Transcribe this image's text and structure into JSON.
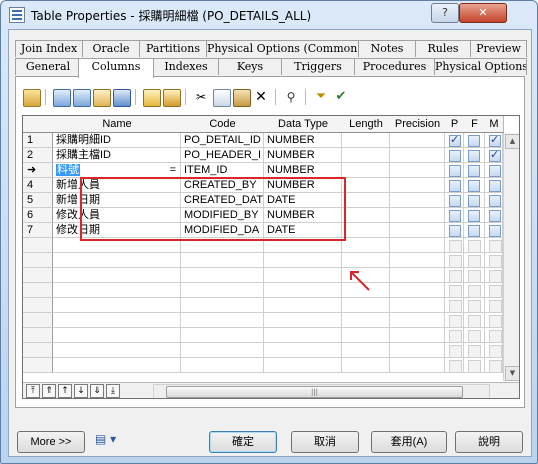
{
  "window": {
    "title": "Table Properties - 採購明細檔 (PO_DETAILS_ALL)",
    "help_glyph": "?",
    "close_glyph": "✕"
  },
  "tabs_row1": [
    "Join Index",
    "Oracle",
    "Partitions",
    "Physical Options (Common)",
    "Notes",
    "Rules",
    "Preview"
  ],
  "tabs_row2": [
    "General",
    "Columns",
    "Indexes",
    "Keys",
    "Triggers",
    "Procedures",
    "Physical Options"
  ],
  "selected_tab": "Columns",
  "grid": {
    "headers": [
      "Name",
      "Code",
      "Data Type",
      "Length",
      "Precision",
      "P",
      "F",
      "M"
    ],
    "rows": [
      {
        "num": "1",
        "name": "採購明細ID",
        "code": "PO_DETAIL_ID",
        "type": "NUMBER",
        "p": true,
        "f": false,
        "m": true
      },
      {
        "num": "2",
        "name": "採購主檔ID",
        "code": "PO_HEADER_I",
        "type": "NUMBER",
        "p": false,
        "f": false,
        "m": true
      },
      {
        "num": "➜",
        "name": "料號",
        "code": "ITEM_ID",
        "type": "NUMBER",
        "p": false,
        "f": false,
        "m": false,
        "editing": true,
        "marker": "="
      },
      {
        "num": "4",
        "name": "新增人員",
        "code": "CREATED_BY",
        "type": "NUMBER",
        "p": false,
        "f": false,
        "m": false
      },
      {
        "num": "5",
        "name": "新增日期",
        "code": "CREATED_DAT",
        "type": "DATE",
        "p": false,
        "f": false,
        "m": false
      },
      {
        "num": "6",
        "name": "修改人員",
        "code": "MODIFIED_BY",
        "type": "NUMBER",
        "p": false,
        "f": false,
        "m": false
      },
      {
        "num": "7",
        "name": "修改日期",
        "code": "MODIFIED_DA",
        "type": "DATE",
        "p": false,
        "f": false,
        "m": false
      }
    ],
    "scroll_glyph": "|||"
  },
  "buttons": {
    "more": "More >>",
    "ok": "確定",
    "cancel": "取消",
    "apply": "套用(A)",
    "help": "說明"
  },
  "colors": {
    "highlight": "#d8262b",
    "selection": "#3399ff"
  }
}
